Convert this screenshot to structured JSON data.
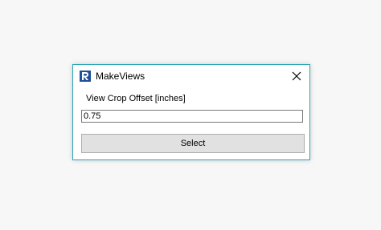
{
  "window": {
    "title": "MakeViews",
    "icon": "revit-icon",
    "close_icon": "close-icon"
  },
  "form": {
    "label": "View Crop Offset [inches]",
    "input_value": "0.75",
    "button_label": "Select"
  },
  "colors": {
    "border_accent": "#2aa7b8",
    "button_bg": "#e1e1e1",
    "icon_blue": "#1f4e9a"
  }
}
